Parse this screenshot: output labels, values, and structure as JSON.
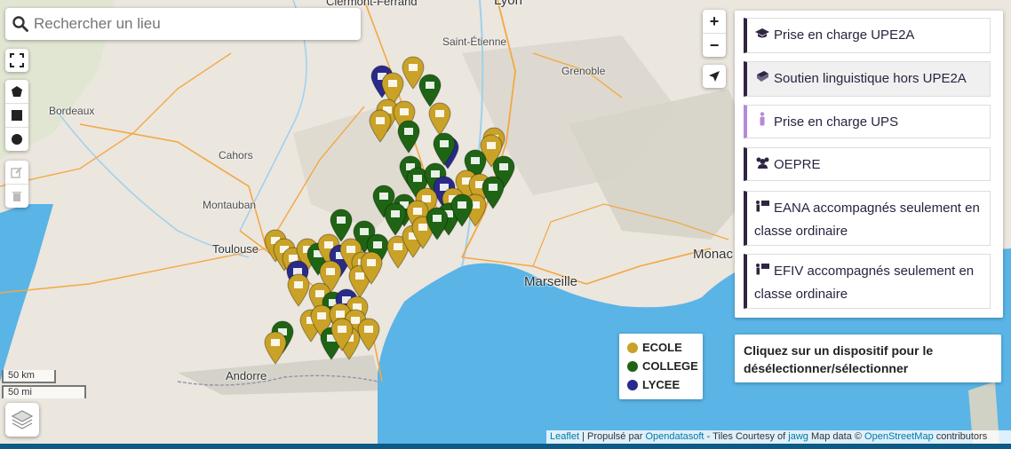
{
  "search": {
    "placeholder": "Rechercher un lieu"
  },
  "zoom": {
    "in": "+",
    "out": "−"
  },
  "places": {
    "clermont": "Clermont-Ferrand",
    "lyon": "Lyon",
    "saint_etienne": "Saint-Étienne",
    "grenoble": "Grenoble",
    "bordeaux": "Bordeaux",
    "cahors": "Cahors",
    "montauban": "Montauban",
    "toulouse": "Toulouse",
    "andorre": "Andorre",
    "marseille": "Marseille",
    "monaco": "Monac"
  },
  "dispositifs": [
    {
      "label": "Prise en charge UPE2A",
      "icon": "graduation-cap-icon",
      "color": "#2f2541"
    },
    {
      "label": "Soutien linguistique hors UPE2A",
      "icon": "book-icon",
      "color": "#2f2541"
    },
    {
      "label": "Prise en charge UPS",
      "icon": "person-icon",
      "color": "#b48ad8"
    },
    {
      "label": "OEPRE",
      "icon": "users-icon",
      "color": "#2f2541"
    },
    {
      "label": "EANA accompagnés seulement en classe ordinaire",
      "icon": "teacher-board-icon",
      "color": "#2f2541"
    },
    {
      "label": "EFIV accompagnés seulement en classe ordinaire",
      "icon": "teacher-board-icon",
      "color": "#2f2541"
    }
  ],
  "legend": [
    {
      "label": "ECOLE",
      "color": "#c9a227"
    },
    {
      "label": "COLLEGE",
      "color": "#1e6414"
    },
    {
      "label": "LYCEE",
      "color": "#2a2a8a"
    }
  ],
  "hint": "Cliquez sur un dispositif pour le désélectionner/sélectionner",
  "scale": {
    "km": "50 km",
    "mi": "50 mi"
  },
  "attribution": {
    "leaflet": "Leaflet",
    "sep1": " | Propulsé par ",
    "ods": "Opendatasoft",
    "sep2": " - Tiles Courtesy of ",
    "jawg": "jawg",
    "sep3": " Map data © ",
    "osm": "OpenStreetMap",
    "sep4": " contributors"
  },
  "colors": {
    "ecole": "#c9a227",
    "college": "#1e6414",
    "lycee": "#2a2a8a",
    "sea": "#5ab4e6"
  }
}
